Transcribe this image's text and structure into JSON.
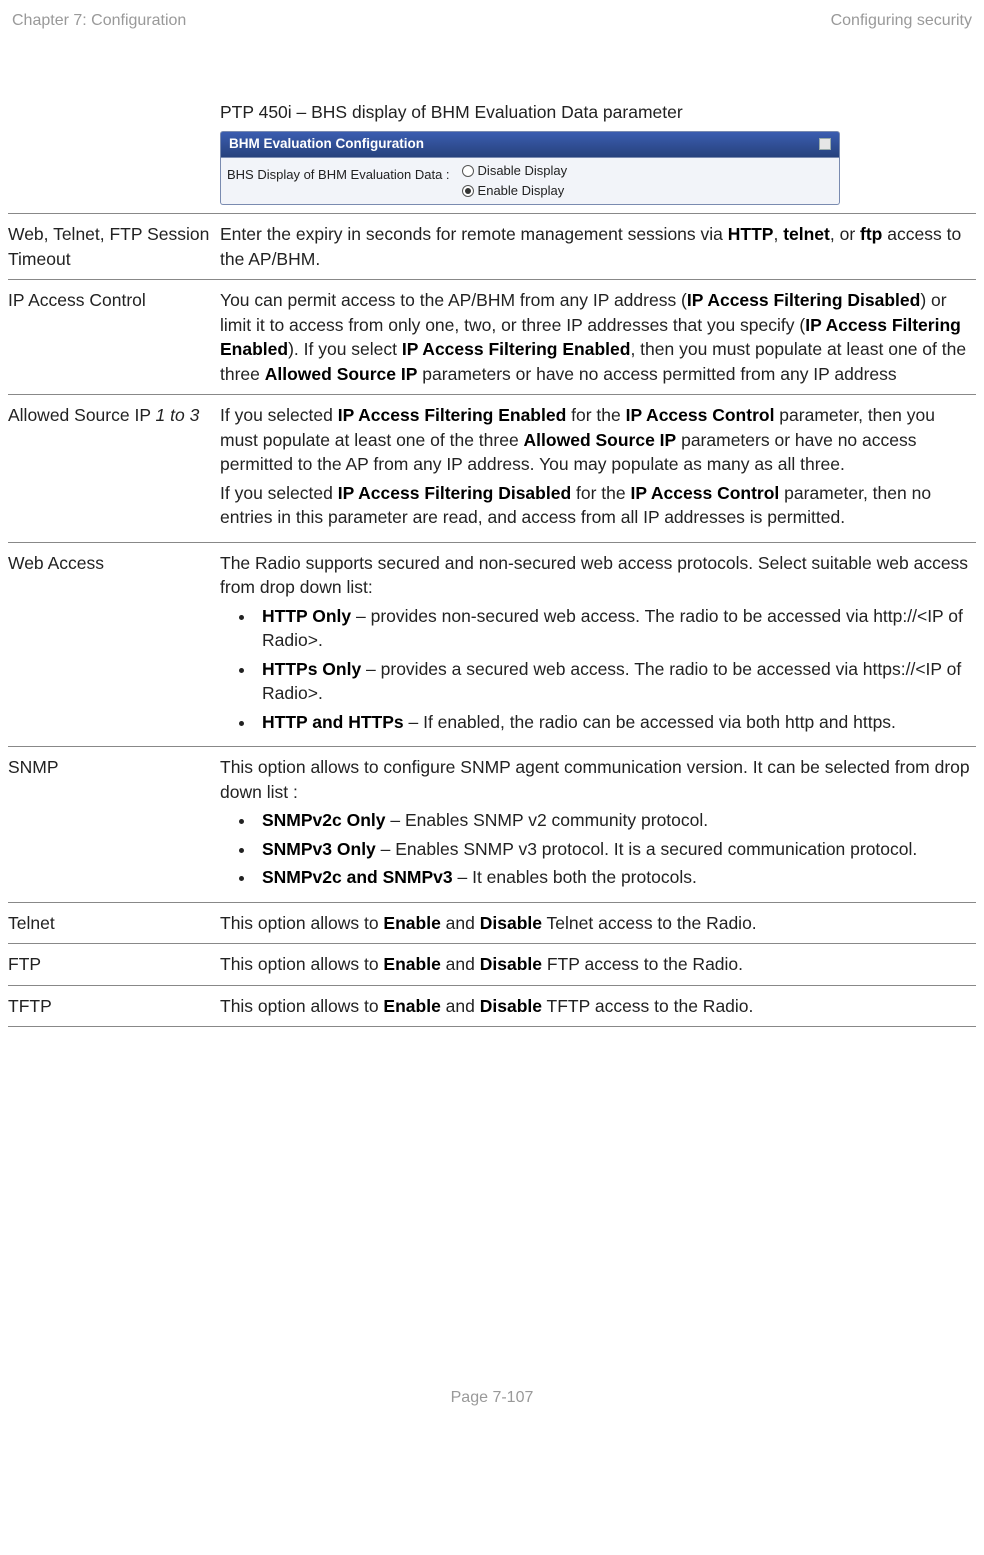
{
  "header": {
    "left": "Chapter 7:  Configuration",
    "right": "Configuring security"
  },
  "figure": {
    "caption": "PTP 450i – BHS display of BHM Evaluation Data parameter",
    "panel_title": "BHM Evaluation Configuration",
    "row_label": "BHS Display of BHM Evaluation Data :",
    "opt1": "Disable Display",
    "opt2": "Enable Display"
  },
  "rows": {
    "webTimeout": {
      "attr": "Web, Telnet, FTP Session Timeout",
      "p1a": "Enter the expiry in seconds for remote management sessions via ",
      "http": "HTTP",
      "p1b": ", ",
      "telnet": "telnet",
      "p1c": ", or ",
      "ftp": "ftp",
      "p1d": " access to the AP/BHM."
    },
    "ipAccess": {
      "attr": "IP Access Control",
      "p1a": "You can permit access to the AP/BHM from any IP address (",
      "b1": "IP Access Filtering Disabled",
      "p1b": ") or limit it to access from only one, two, or three IP addresses that you specify (",
      "b2": "IP Access Filtering Enabled",
      "p1c": "). If you select ",
      "b3": "IP Access Filtering Enabled",
      "p1d": ", then you must populate at least one of the three ",
      "b4": "Allowed Source IP",
      "p1e": " parameters or have no access permitted from any IP address"
    },
    "allowed": {
      "attr_a": "Allowed Source IP ",
      "attr_i": "1 to 3",
      "p1a": "If you selected ",
      "b1": "IP Access Filtering Enabled",
      "p1b": " for the ",
      "b2": "IP Access Control",
      "p1c": " parameter, then you must populate at least one of the three ",
      "b3": "Allowed Source IP",
      "p1d": " parameters or have no access permitted to the AP from any IP address. You may populate as many as all three.",
      "p2a": "If you selected ",
      "b4": "IP Access Filtering Disabled",
      "p2b": " for the ",
      "b5": "IP Access Control",
      "p2c": " parameter, then no entries in this parameter are read, and access from all IP addresses is permitted."
    },
    "webAccess": {
      "attr": "Web Access",
      "intro": "The Radio supports secured and non-secured web access protocols. Select suitable web access from drop down list:",
      "li1b": "HTTP Only",
      "li1t": " – provides non-secured web access. The radio to be accessed via http://<IP of Radio>.",
      "li2b": "HTTPs Only",
      "li2t": " – provides a secured web access. The radio to be accessed via https://<IP of Radio>.",
      "li3b": "HTTP and HTTPs",
      "li3t": " – If enabled, the radio can be accessed via both http and https."
    },
    "snmp": {
      "attr": "SNMP",
      "intro": "This option allows to configure SNMP agent communication version. It can be selected from drop down list :",
      "li1b": "SNMPv2c Only",
      "li1t": " – Enables SNMP v2 community protocol.",
      "li2b": "SNMPv3 Only",
      "li2t": " – Enables SNMP v3 protocol. It is a secured communication protocol.",
      "li3b": "SNMPv2c and SNMPv3",
      "li3t": " – It enables both the protocols."
    },
    "telnet": {
      "attr": "Telnet",
      "p1a": "This option allows to ",
      "b1": "Enable",
      "p1b": " and ",
      "b2": "Disable",
      "p1c": " Telnet access to the Radio."
    },
    "ftp": {
      "attr": "FTP",
      "p1a": "This option allows to ",
      "b1": "Enable",
      "p1b": " and ",
      "b2": "Disable",
      "p1c": " FTP access to the Radio."
    },
    "tftp": {
      "attr": "TFTP",
      "p1a": "This option allows to ",
      "b1": "Enable",
      "p1b": " and ",
      "b2": "Disable",
      "p1c": " TFTP access to the Radio."
    }
  },
  "footer": "Page 7-107"
}
